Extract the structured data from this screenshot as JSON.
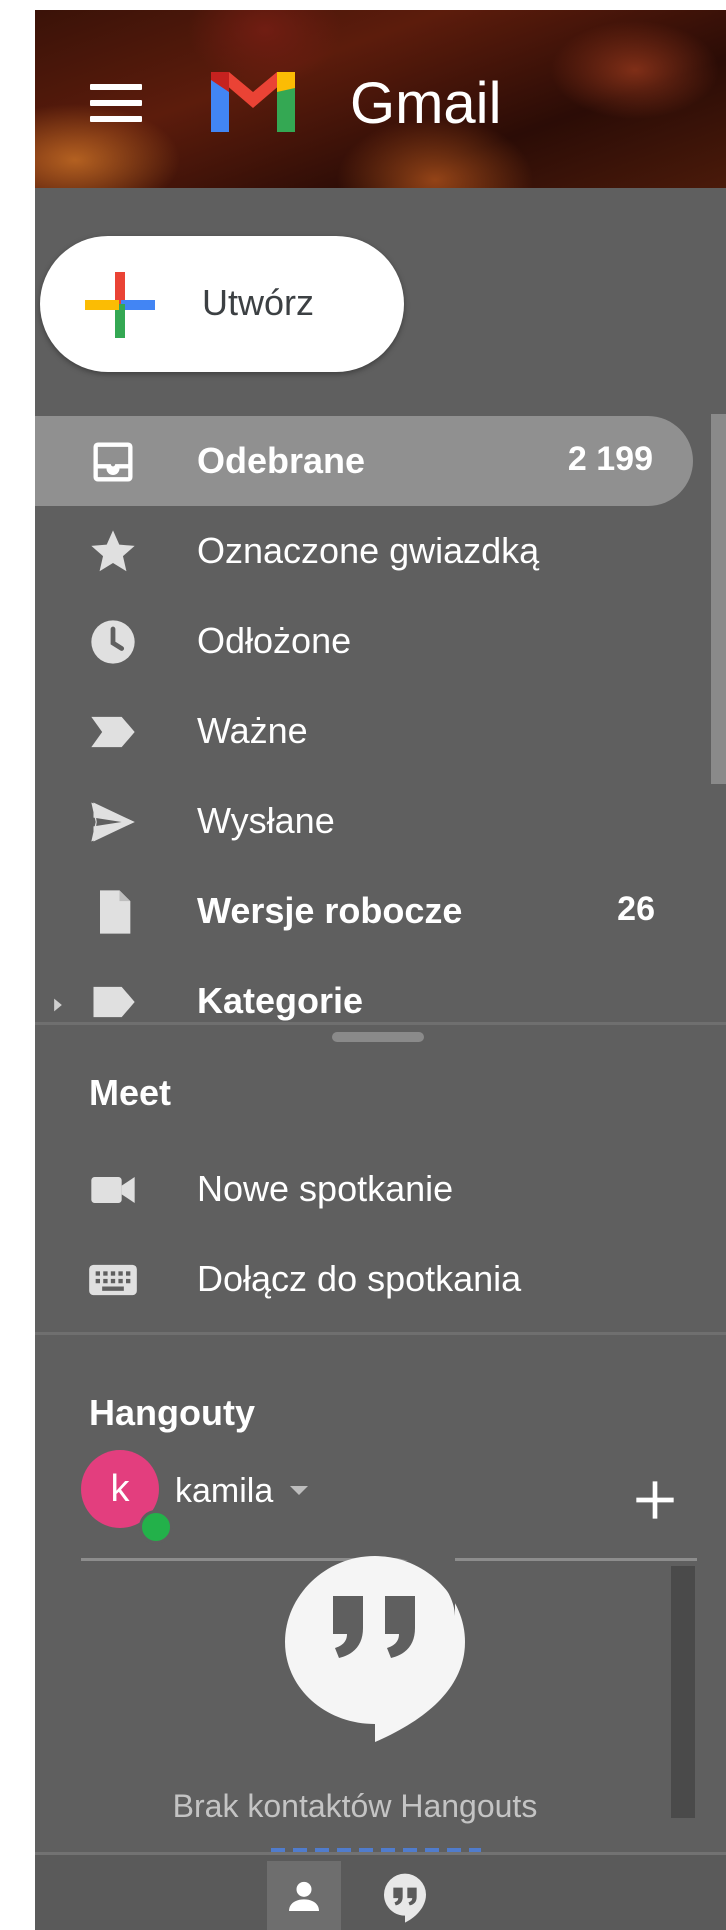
{
  "header": {
    "brand": "Gmail"
  },
  "compose": {
    "label": "Utwórz"
  },
  "nav": [
    {
      "label": "Odebrane",
      "count": "2 199",
      "icon": "inbox-icon",
      "bold": true,
      "active": true
    },
    {
      "label": "Oznaczone gwiazdką",
      "icon": "star-icon"
    },
    {
      "label": "Odłożone",
      "icon": "clock-icon"
    },
    {
      "label": "Ważne",
      "icon": "important-icon"
    },
    {
      "label": "Wysłane",
      "icon": "send-icon"
    },
    {
      "label": "Wersje robocze",
      "count": "26",
      "icon": "draft-icon",
      "bold": true
    },
    {
      "label": "Kategorie",
      "icon": "label-icon",
      "bold": true
    }
  ],
  "meet": {
    "title": "Meet",
    "items": [
      {
        "label": "Nowe spotkanie",
        "icon": "video-camera-icon"
      },
      {
        "label": "Dołącz do spotkania",
        "icon": "keyboard-icon"
      }
    ]
  },
  "hangouts": {
    "title": "Hangouty",
    "user": {
      "initial": "k",
      "name": "kamila",
      "avatar_color": "#e33e7e",
      "presence_color": "#23b14a"
    },
    "empty_text": "Brak kontaktów Hangouts"
  },
  "colors": {
    "sidebar_bg": "#5f5f5f",
    "active_bg": "#909090",
    "gmail_red": "#ea4335",
    "gmail_blue": "#4285f4",
    "gmail_green": "#34a853",
    "gmail_yellow": "#fbbc04"
  }
}
